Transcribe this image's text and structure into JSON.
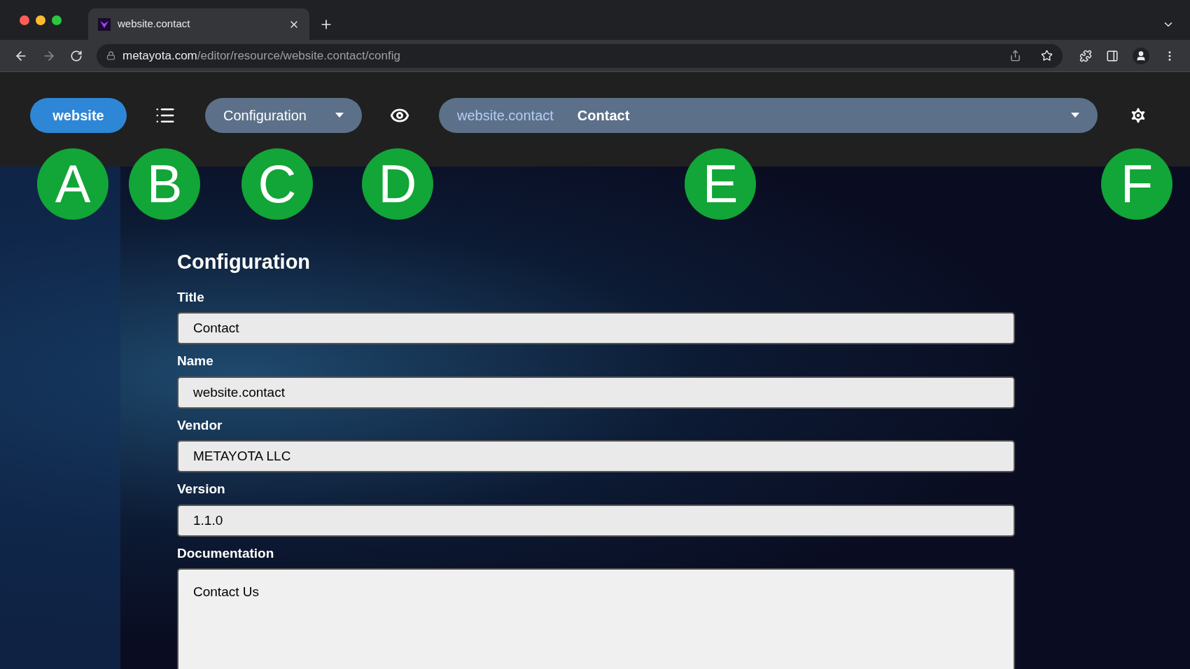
{
  "browser": {
    "tab_title": "website.contact",
    "url_host": "metayota.com",
    "url_path": "/editor/resource/website.contact/config"
  },
  "toolbar": {
    "app_button": "website",
    "view_select": "Configuration",
    "resource_select": {
      "name": "website.contact",
      "title": "Contact"
    }
  },
  "callouts": [
    "A",
    "B",
    "C",
    "D",
    "E",
    "F"
  ],
  "form": {
    "heading": "Configuration",
    "fields": [
      {
        "label": "Title",
        "value": "Contact",
        "kind": "input"
      },
      {
        "label": "Name",
        "value": "website.contact",
        "kind": "input"
      },
      {
        "label": "Vendor",
        "value": "METAYOTA LLC",
        "kind": "input"
      },
      {
        "label": "Version",
        "value": "1.1.0",
        "kind": "input"
      },
      {
        "label": "Documentation",
        "value": "Contact Us",
        "kind": "textarea"
      }
    ]
  }
}
